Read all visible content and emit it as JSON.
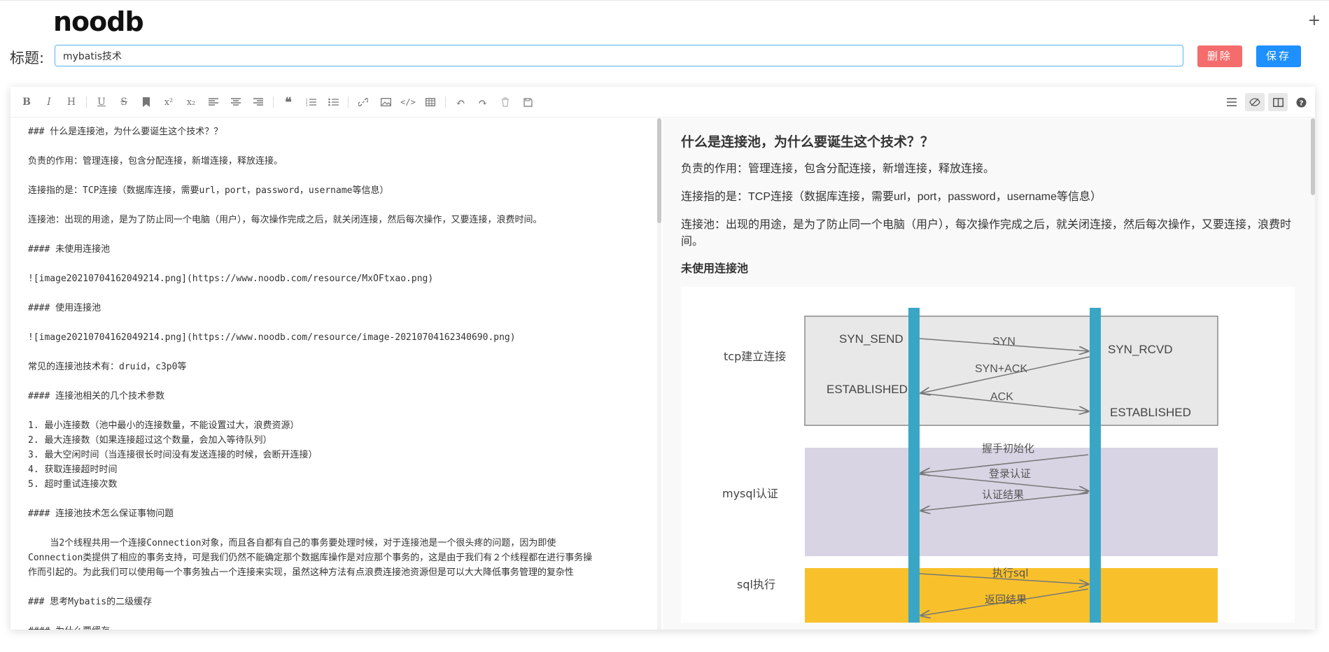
{
  "header": {
    "logo": "noodb",
    "add_label": "+"
  },
  "title_row": {
    "label": "标题:",
    "value": "mybatis技术",
    "delete_label": "删除",
    "save_label": "保存"
  },
  "toolbar": {
    "left_icons": [
      "bold-icon",
      "italic-icon",
      "heading-icon",
      "underline-icon",
      "strikethrough-icon",
      "bookmark-icon",
      "superscript-icon",
      "subscript-icon",
      "align-left-icon",
      "align-center-icon",
      "align-right-icon",
      "quote-icon",
      "ordered-list-icon",
      "unordered-list-icon",
      "link-icon",
      "image-icon",
      "code-icon",
      "table-icon",
      "undo-icon",
      "redo-icon",
      "trash-icon",
      "save-icon"
    ],
    "right_icons": [
      "menu-icon",
      "preview-icon",
      "split-view-icon",
      "help-icon"
    ]
  },
  "markdown_lines": [
    "### 什么是连接池，为什么要诞生这个技术？？",
    "",
    "负责的作用：管理连接，包含分配连接，新增连接，释放连接。",
    "",
    "连接指的是：TCP连接（数据库连接，需要url，port，password，username等信息）",
    "",
    "连接池：出现的用途，是为了防止同一个电脑（用户），每次操作完成之后，就关闭连接，然后每次操作，又要连接，浪费时间。",
    "",
    "#### 未使用连接池",
    "",
    "![image20210704162049214.png](https://www.noodb.com/resource/MxOFtxao.png)",
    "",
    "#### 使用连接池",
    "",
    "![image20210704162049214.png](https://www.noodb.com/resource/image-20210704162340690.png)",
    "",
    "常见的连接池技术有：druid，c3p0等",
    "",
    "#### 连接池相关的几个技术参数",
    "",
    "1. 最小连接数（池中最小的连接数量，不能设置过大，浪费资源）",
    "2. 最大连接数（如果连接超过这个数量，会加入等待队列）",
    "3. 最大空闲时间（当连接很长时间没有发送连接的时候，会断开连接）",
    "4. 获取连接超时时间",
    "5. 超时重试连接次数",
    "",
    "#### 连接池技术怎么保证事物问题",
    "",
    "    当2个线程共用一个连接Connection对象，而且各自都有自己的事务要处理时候，对于连接池是一个很头疼的问题，因为即使",
    "Connection类提供了相应的事务支持，可是我们仍然不能确定那个数据库操作是对应那个事务的，这是由于我们有２个线程都在进行事务操",
    "作而引起的。为此我们可以使用每一个事务独占一个连接来实现，虽然这种方法有点浪费连接池资源但是可以大大降低事务管理的复杂性",
    "",
    "### 思考Mybatis的二级缓存",
    "",
    "#### 为什么要缓存"
  ],
  "preview": {
    "h3": "什么是连接池，为什么要诞生这个技术？？",
    "p1": "负责的作用：管理连接，包含分配连接，新增连接，释放连接。",
    "p2": "连接指的是：TCP连接（数据库连接，需要url，port，password，username等信息）",
    "p3": "连接池：出现的用途，是为了防止同一个电脑（用户），每次操作完成之后，就关闭连接，然后每次操作，又要连接，浪费时间。",
    "h4": "未使用连接池"
  },
  "diagram": {
    "stage_tcp": "tcp建立连接",
    "stage_mysql": "mysql认证",
    "stage_sql": "sql执行",
    "syn_send": "SYN_SEND",
    "syn_rcvd": "SYN_RCVD",
    "established_left": "ESTABLISHED",
    "established_right": "ESTABLISHED",
    "syn": "SYN",
    "syn_ack": "SYN+ACK",
    "ack": "ACK",
    "handshake_init": "握手初始化",
    "login_auth": "登录认证",
    "auth_result": "认证结果",
    "exec_sql": "执行sql",
    "return_result": "返回结果",
    "colors": {
      "tcp_box": "#e8e8e8",
      "mysql_box": "#d8d4e4",
      "sql_box": "#f8c12c",
      "lifeline": "#3aa6c6"
    }
  }
}
